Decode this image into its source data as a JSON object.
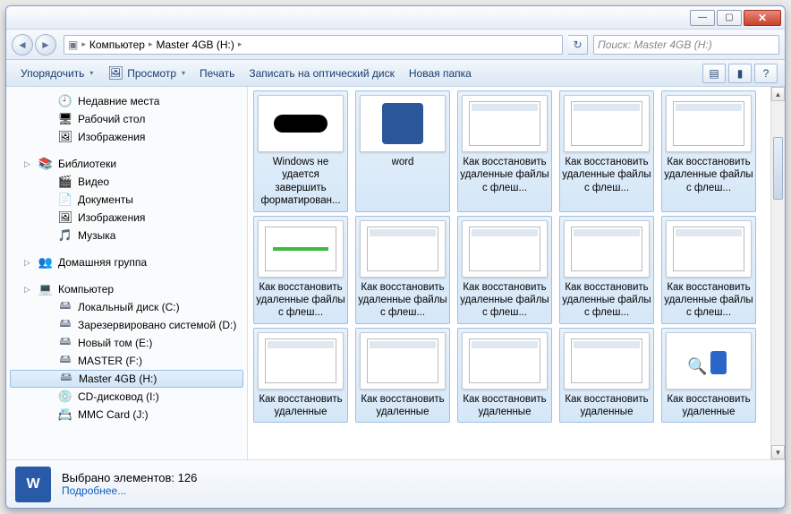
{
  "titlebar": {
    "minimize": "—",
    "maximize": "▢",
    "close": "✕"
  },
  "nav": {
    "back": "◄",
    "forward": "►",
    "drop": "▾"
  },
  "address": {
    "root_icon": "▣",
    "sep": "▸",
    "crumb1": "Компьютер",
    "crumb2": "Master 4GB (H:)"
  },
  "refresh_icon": "↻",
  "search": {
    "placeholder": "Поиск: Master 4GB (H:)"
  },
  "toolbar": {
    "organize": "Упорядочить",
    "preview": "Просмотр",
    "print": "Печать",
    "burn": "Записать на оптический диск",
    "newfolder": "Новая папка",
    "view_icon": "▤",
    "preview_icon": "▮",
    "help_icon": "?"
  },
  "sidebar": {
    "favorites": [
      {
        "icon": "🕘",
        "label": "Недавние места"
      },
      {
        "icon": "🖥",
        "label": "Рабочий стол"
      },
      {
        "icon": "🖼",
        "label": "Изображения"
      }
    ],
    "libraries": {
      "header": "Библиотеки",
      "icon": "📚",
      "items": [
        {
          "icon": "🎬",
          "label": "Видео"
        },
        {
          "icon": "📄",
          "label": "Документы"
        },
        {
          "icon": "🖼",
          "label": "Изображения"
        },
        {
          "icon": "🎵",
          "label": "Музыка"
        }
      ]
    },
    "homegroup": {
      "icon": "👥",
      "label": "Домашняя группа"
    },
    "computer": {
      "header": "Компьютер",
      "icon": "💻",
      "items": [
        {
          "icon": "🖴",
          "label": "Локальный диск (C:)"
        },
        {
          "icon": "🖴",
          "label": "Зарезервировано системой (D:)"
        },
        {
          "icon": "🖴",
          "label": "Новый том (E:)"
        },
        {
          "icon": "🖴",
          "label": "MASTER (F:)"
        },
        {
          "icon": "🖴",
          "label": "Master 4GB (H:)",
          "selected": true
        },
        {
          "icon": "💿",
          "label": "CD-дисковод (I:)"
        },
        {
          "icon": "📇",
          "label": "MMC Card (J:)"
        }
      ]
    }
  },
  "files": {
    "row1": [
      {
        "kind": "usb",
        "label": "Windows не удается завершить форматирован..."
      },
      {
        "kind": "word",
        "label": "word"
      },
      {
        "kind": "win",
        "label": "Как восстановить удаленные файлы с флеш..."
      },
      {
        "kind": "win",
        "label": "Как восстановить удаленные файлы с флеш..."
      },
      {
        "kind": "win",
        "label": "Как восстановить удаленные файлы с флеш..."
      }
    ],
    "row2": [
      {
        "kind": "green",
        "label": "Как восстановить удаленные файлы с флеш..."
      },
      {
        "kind": "win",
        "label": "Как восстановить удаленные файлы с флеш..."
      },
      {
        "kind": "win",
        "label": "Как восстановить удаленные файлы с флеш..."
      },
      {
        "kind": "win",
        "label": "Как восстановить удаленные файлы с флеш..."
      },
      {
        "kind": "win",
        "label": "Как восстановить удаленные файлы с флеш..."
      }
    ],
    "row3": [
      {
        "kind": "win",
        "label": "Как восстановить удаленные"
      },
      {
        "kind": "win",
        "label": "Как восстановить удаленные"
      },
      {
        "kind": "win",
        "label": "Как восстановить удаленные"
      },
      {
        "kind": "win",
        "label": "Как восстановить удаленные"
      },
      {
        "kind": "usb2",
        "label": "Как восстановить удаленные"
      }
    ]
  },
  "details": {
    "title": "Выбрано элементов: 126",
    "link": "Подробнее..."
  },
  "scrollbar": {
    "up": "▲",
    "down": "▼"
  }
}
